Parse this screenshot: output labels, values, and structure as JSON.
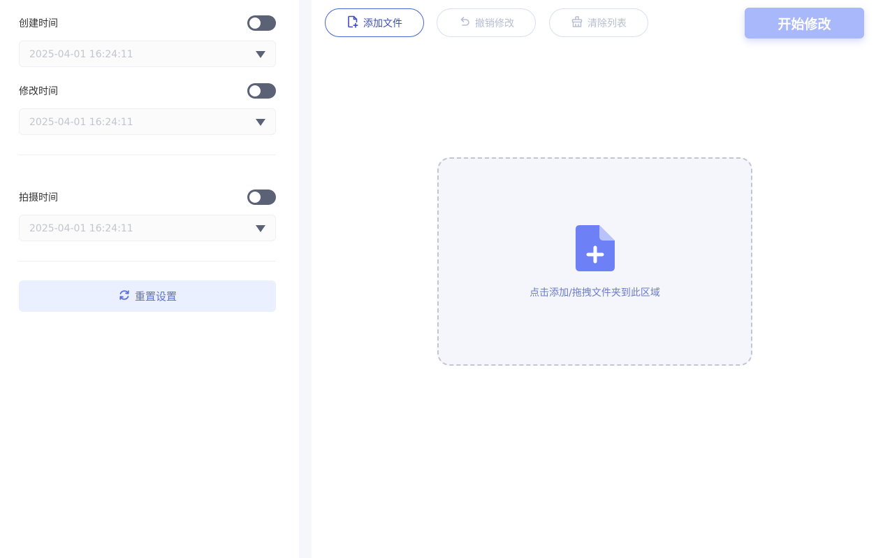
{
  "settings": {
    "create_time": {
      "label": "创建时间",
      "value": "2025-04-01 16:24:11"
    },
    "modify_time": {
      "label": "修改时间",
      "value": "2025-04-01 16:24:11"
    },
    "shoot_time": {
      "label": "拍摄时间",
      "value": "2025-04-01 16:24:11"
    },
    "reset_label": "重置设置"
  },
  "toolbar": {
    "add_file_label": "添加文件",
    "undo_label": "撤销修改",
    "clear_label": "清除列表",
    "start_label": "开始修改"
  },
  "dropzone": {
    "hint": "点击添加/拖拽文件夹到此区域"
  },
  "colors": {
    "accent": "#4c63d6",
    "toggle_off": "#5b6275",
    "start_button": "#a9b8fb",
    "dropzone_bg": "#f5f6fb"
  },
  "icons": {
    "add_file": "file-plus-icon",
    "undo": "undo-icon",
    "clear": "broom-icon",
    "reset": "refresh-icon",
    "dropzone": "file-plus-icon",
    "select": "caret-down-icon"
  }
}
